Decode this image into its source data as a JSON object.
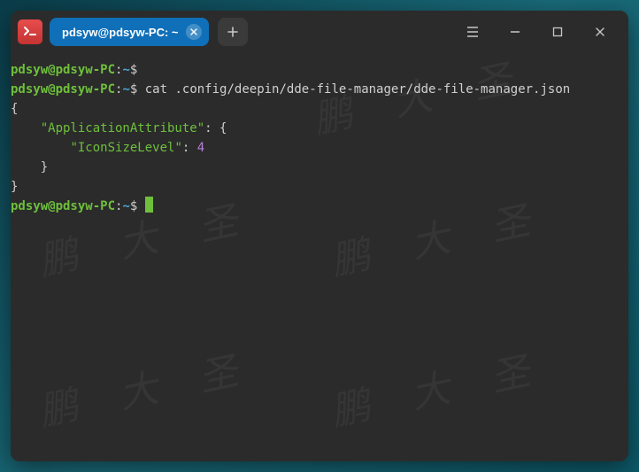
{
  "titlebar": {
    "tab_label": "pdsyw@pdsyw-PC: ~"
  },
  "prompt": {
    "user_host": "pdsyw@pdsyw-PC",
    "sep1": ":",
    "path": "~",
    "sep2": "$"
  },
  "lines": {
    "l1_cmd": "",
    "l2_cmd": " cat .config/deepin/dde-file-manager/dde-file-manager.json"
  },
  "json_out": {
    "open": "{",
    "k1_indent": "    ",
    "k1": "\"ApplicationAttribute\"",
    "k1_after": ": {",
    "k2_indent": "        ",
    "k2": "\"IconSizeLevel\"",
    "k2_after": ": ",
    "k2_val": "4",
    "close_inner_indent": "    ",
    "close_inner": "}",
    "close": "}"
  },
  "watermark": "鹏 大 圣"
}
